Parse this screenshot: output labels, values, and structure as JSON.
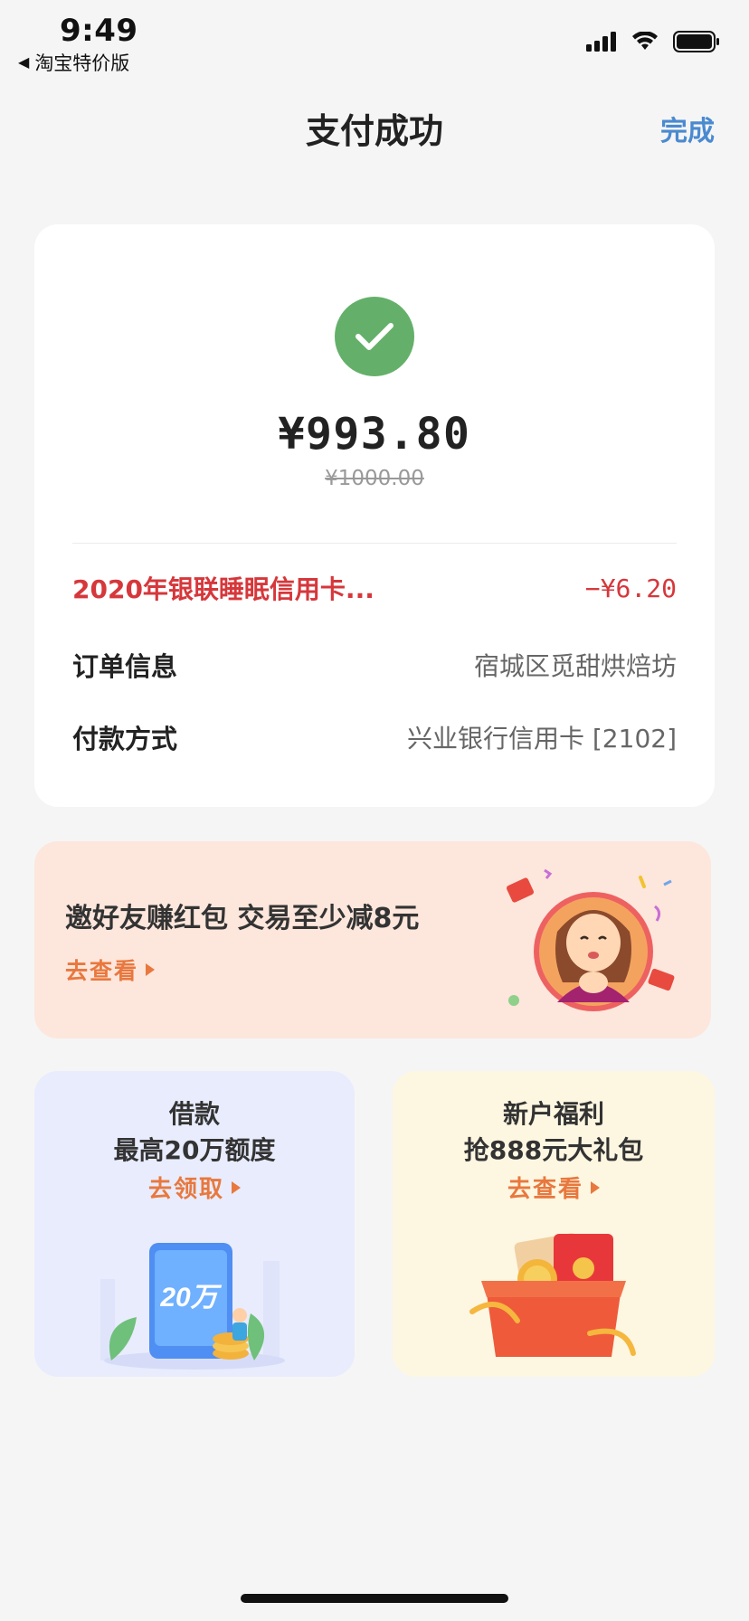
{
  "status_bar": {
    "time": "9:49",
    "back_app": "淘宝特价版"
  },
  "nav": {
    "title": "支付成功",
    "done_label": "完成"
  },
  "payment": {
    "amount": "¥993.80",
    "original_amount": "¥1000.00",
    "promo_label": "2020年银联睡眠信用卡...",
    "promo_value": "−¥6.20",
    "order_label": "订单信息",
    "order_value": "宿城区觅甜烘焙坊",
    "method_label": "付款方式",
    "method_value": "兴业银行信用卡 [2102]"
  },
  "invite": {
    "title": "邀好友赚红包 交易至少减8元",
    "link": "去查看"
  },
  "loan_card": {
    "line1": "借款",
    "line2": "最高20万额度",
    "link": "去领取",
    "phone_amount": "20万"
  },
  "newuser_card": {
    "line1": "新户福利",
    "line2": "抢888元大礼包",
    "link": "去查看"
  },
  "colors": {
    "accent_blue": "#4a8ad0",
    "success_green": "#64b06a",
    "promo_red": "#d6373b",
    "link_orange": "#e8783e"
  },
  "icons": [
    "back-triangle-icon",
    "signal-icon",
    "wifi-icon",
    "battery-icon",
    "check-icon",
    "play-triangle-icon"
  ]
}
